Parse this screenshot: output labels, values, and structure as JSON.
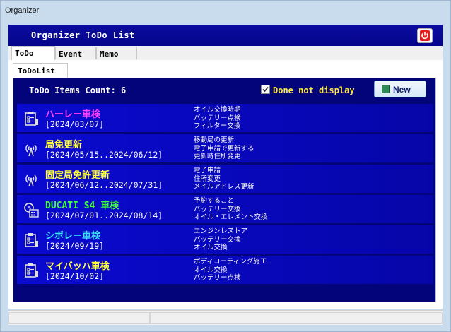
{
  "window": {
    "title": "Organizer"
  },
  "header": {
    "title": "Organizer ToDo List"
  },
  "tabs": [
    {
      "label": "ToDo",
      "active": true
    },
    {
      "label": "Event",
      "active": false
    },
    {
      "label": "Memo",
      "active": false
    }
  ],
  "subtabs": [
    {
      "label": "ToDoList"
    }
  ],
  "list_header": {
    "count_label": "ToDo Items Count: 6",
    "done_not_display_label": "Done not display",
    "done_not_display_checked": true,
    "new_button_label": "New"
  },
  "colors": {
    "header_bg": "#04058a",
    "list_bg": "#03037a",
    "item_bg": "#0808c8",
    "yellow": "#ffff40",
    "magenta": "#ff40ff",
    "green": "#40ff40",
    "cyan": "#40e0ff"
  },
  "items": [
    {
      "icon": "clipboard-icon",
      "name": "ハーレー車検",
      "name_color": "#ff40ff",
      "date": "[2024/03/07]",
      "details": [
        "オイル交換時期",
        "バッテリー点検",
        "フィルター交換"
      ]
    },
    {
      "icon": "antenna-icon",
      "name": "局免更新",
      "name_color": "#ffff40",
      "date": "[2024/05/15..2024/06/12]",
      "details": [
        "移動局の更新",
        "電子申請で更新する",
        "更新時住所変更"
      ]
    },
    {
      "icon": "antenna-icon",
      "name": "固定局免許更新",
      "name_color": "#ffff40",
      "date": "[2024/06/12..2024/07/31]",
      "details": [
        "電子申請",
        "住所変更",
        "メイルアドレス更新"
      ]
    },
    {
      "icon": "clock-calendar-icon",
      "name": "DUCATI S4 車検",
      "name_color": "#40ff40",
      "date": "[2024/07/01..2024/08/14]",
      "details": [
        "予約すること",
        "バッテリー交換",
        "オイル・エレメント交換"
      ]
    },
    {
      "icon": "clipboard-icon",
      "name": "シボレー車検",
      "name_color": "#40e0ff",
      "date": "[2024/09/19]",
      "details": [
        "エンジンレストア",
        "バッテリー交換",
        "オイル交換"
      ]
    },
    {
      "icon": "clipboard-icon",
      "name": "マイバッハ車検",
      "name_color": "#ffff40",
      "date": "[2024/10/02]",
      "details": [
        "ボディコーティング施工",
        "オイル交換",
        "バッテリー点検"
      ]
    }
  ]
}
